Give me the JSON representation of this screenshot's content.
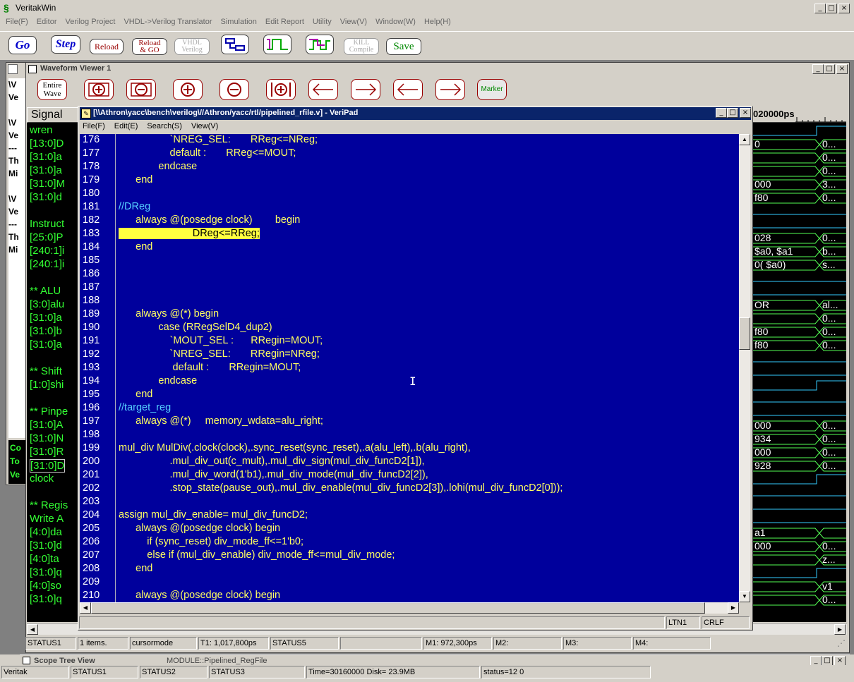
{
  "app": {
    "title": "VeritakWin",
    "menu": [
      "File(F)",
      "Editor",
      "Verilog Project",
      "VHDL->Verilog Translator",
      "Simulation",
      "Edit Report",
      "Utility",
      "View(V)",
      "Window(W)",
      "Help(H)"
    ],
    "toolbar": {
      "go": "Go",
      "step": "Step",
      "reload": "Reload",
      "reload_go_1": "Reload",
      "reload_go_2": "& GO",
      "vhdl_1": "VHDL",
      "vhdl_2": "Verilog",
      "kill_1": "KILL",
      "kill_2": "Compile",
      "save": "Save"
    }
  },
  "waveform": {
    "title": "Waveform Viewer 1",
    "entire_1": "Entire",
    "entire_2": "Wave",
    "marker": "Marker",
    "signal_header": "Signal",
    "time_header": "020000ps",
    "signals": [
      "wren",
      "[13:0]D",
      "[31:0]a",
      "[31:0]a",
      "[31:0]M",
      "[31:0]d",
      "",
      "Instruct",
      "[25:0]P",
      "[240:1]i",
      "[240:1]i",
      "",
      "** ALU",
      "[3:0]alu",
      "[31:0]a",
      "[31:0]b",
      "[31:0]a",
      "",
      "** Shift",
      "[1:0]shi",
      "",
      "** Pinpe",
      "[31:0]A",
      "[31:0]N",
      "[31:0]R",
      "[31:0]D",
      "clock",
      "",
      "** Regis",
      " Write A",
      "[4:0]da",
      "[31:0]d",
      "[4:0]ta",
      "[31:0]q",
      "[4:0]so",
      "[31:0]q"
    ],
    "values_left": [
      "",
      "0",
      "",
      "",
      "000",
      "f80",
      "",
      "",
      "028",
      "$a0, $a1",
      "0( $a0)",
      "",
      "",
      "OR",
      "",
      "f80",
      "f80",
      "",
      "",
      "",
      "",
      "",
      "000",
      "934",
      "000",
      "928",
      "",
      "",
      "",
      "",
      "a1",
      "000",
      "",
      "",
      "",
      ""
    ],
    "values_right": [
      "",
      "0...",
      "0...",
      "0...",
      "3...",
      "0...",
      "",
      "",
      "0...",
      "b...",
      "s...",
      "",
      "",
      "al...",
      "0...",
      "0...",
      "0...",
      "",
      "",
      "",
      "",
      "",
      "0...",
      "0...",
      "0...",
      "0...",
      "",
      "",
      "",
      "",
      "",
      "0...",
      "z...",
      "",
      "v1",
      "0..."
    ]
  },
  "left_panel": {
    "lines": [
      "\\V",
      "Ve",
      "",
      "\\V",
      "Ve",
      "---",
      "Th",
      "Mi",
      "",
      "\\V",
      "Ve",
      "---",
      "Th",
      "Mi"
    ],
    "bottom_lines": [
      "Co",
      "To",
      "Ve"
    ]
  },
  "veripad": {
    "title": "[\\\\Athron\\yacc\\bench\\verilog\\//Athron/yacc/rtl/pipelined_rfile.v] - VeriPad",
    "menu": [
      "File(F)",
      "Edit(E)",
      "Search(S)",
      "View(V)"
    ],
    "status_ln": "LTN1",
    "status_crlf": "CRLF",
    "lines": [
      {
        "n": "176",
        "t": "                  `NREG_SEL:       RReg<=NReg;"
      },
      {
        "n": "177",
        "t": "                  default :       RReg<=MOUT;"
      },
      {
        "n": "178",
        "t": "              endcase"
      },
      {
        "n": "179",
        "t": "      end"
      },
      {
        "n": "180",
        "t": ""
      },
      {
        "n": "181",
        "t": "//DReg",
        "c": true
      },
      {
        "n": "182",
        "t": "      always @(posedge clock)        begin"
      },
      {
        "n": "183",
        "t": "                          DReg<=RReg;",
        "h": true
      },
      {
        "n": "184",
        "t": "      end"
      },
      {
        "n": "185",
        "t": ""
      },
      {
        "n": "186",
        "t": ""
      },
      {
        "n": "187",
        "t": ""
      },
      {
        "n": "188",
        "t": ""
      },
      {
        "n": "189",
        "t": "      always @(*) begin"
      },
      {
        "n": "190",
        "t": "              case (RRegSelD4_dup2)"
      },
      {
        "n": "191",
        "t": "                  `MOUT_SEL :      RRegin=MOUT;"
      },
      {
        "n": "192",
        "t": "                  `NREG_SEL:       RRegin=NReg;"
      },
      {
        "n": "193",
        "t": "                   default :       RRegin=MOUT;"
      },
      {
        "n": "194",
        "t": "              endcase"
      },
      {
        "n": "195",
        "t": "      end"
      },
      {
        "n": "196",
        "t": "//target_reg",
        "c": true
      },
      {
        "n": "197",
        "t": "      always @(*)     memory_wdata=alu_right;"
      },
      {
        "n": "198",
        "t": ""
      },
      {
        "n": "199",
        "t": "mul_div MulDiv(.clock(clock),.sync_reset(sync_reset),.a(alu_left),.b(alu_right),"
      },
      {
        "n": "200",
        "t": "                  .mul_div_out(c_mult),.mul_div_sign(mul_div_funcD2[1]),"
      },
      {
        "n": "201",
        "t": "                  .mul_div_word(1'b1),.mul_div_mode(mul_div_funcD2[2]),"
      },
      {
        "n": "202",
        "t": "                  .stop_state(pause_out),.mul_div_enable(mul_div_funcD2[3]),.lohi(mul_div_funcD2[0]));"
      },
      {
        "n": "203",
        "t": ""
      },
      {
        "n": "204",
        "t": "assign mul_div_enable= mul_div_funcD2;"
      },
      {
        "n": "205",
        "t": "      always @(posedge clock) begin"
      },
      {
        "n": "206",
        "t": "          if (sync_reset) div_mode_ff<=1'b0;"
      },
      {
        "n": "207",
        "t": "          else if (mul_div_enable) div_mode_ff<=mul_div_mode;"
      },
      {
        "n": "208",
        "t": "      end"
      },
      {
        "n": "209",
        "t": ""
      },
      {
        "n": "210",
        "t": "      always @(posedge clock) begin"
      }
    ]
  },
  "wave_status": [
    "STATUS1",
    "1 items.",
    "cursormode",
    "T1: 1,017,800ps",
    "STATUS5",
    "",
    "M1: 972,300ps",
    "M2:",
    "M3:",
    "M4:"
  ],
  "scope": {
    "title": "Scope Tree View",
    "module": "MODULE::Pipelined_RegFile"
  },
  "main_status": [
    "Veritak",
    "STATUS1",
    "STATUS2",
    "STATUS3",
    "Time=30160000 Disk= 23.9MB",
    "status=12 0"
  ]
}
